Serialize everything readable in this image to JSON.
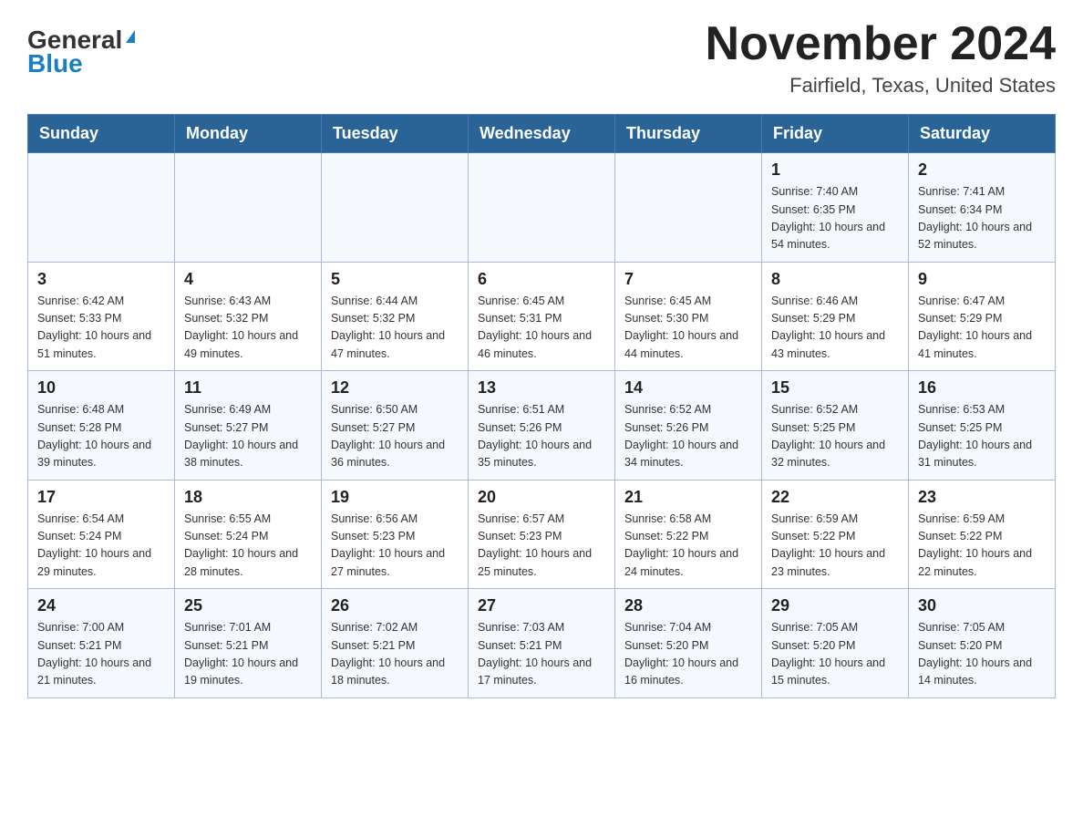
{
  "header": {
    "logo_general": "General",
    "logo_blue": "Blue",
    "title": "November 2024",
    "subtitle": "Fairfield, Texas, United States"
  },
  "calendar": {
    "days_of_week": [
      "Sunday",
      "Monday",
      "Tuesday",
      "Wednesday",
      "Thursday",
      "Friday",
      "Saturday"
    ],
    "weeks": [
      [
        {
          "day": "",
          "info": ""
        },
        {
          "day": "",
          "info": ""
        },
        {
          "day": "",
          "info": ""
        },
        {
          "day": "",
          "info": ""
        },
        {
          "day": "",
          "info": ""
        },
        {
          "day": "1",
          "info": "Sunrise: 7:40 AM\nSunset: 6:35 PM\nDaylight: 10 hours and 54 minutes."
        },
        {
          "day": "2",
          "info": "Sunrise: 7:41 AM\nSunset: 6:34 PM\nDaylight: 10 hours and 52 minutes."
        }
      ],
      [
        {
          "day": "3",
          "info": "Sunrise: 6:42 AM\nSunset: 5:33 PM\nDaylight: 10 hours and 51 minutes."
        },
        {
          "day": "4",
          "info": "Sunrise: 6:43 AM\nSunset: 5:32 PM\nDaylight: 10 hours and 49 minutes."
        },
        {
          "day": "5",
          "info": "Sunrise: 6:44 AM\nSunset: 5:32 PM\nDaylight: 10 hours and 47 minutes."
        },
        {
          "day": "6",
          "info": "Sunrise: 6:45 AM\nSunset: 5:31 PM\nDaylight: 10 hours and 46 minutes."
        },
        {
          "day": "7",
          "info": "Sunrise: 6:45 AM\nSunset: 5:30 PM\nDaylight: 10 hours and 44 minutes."
        },
        {
          "day": "8",
          "info": "Sunrise: 6:46 AM\nSunset: 5:29 PM\nDaylight: 10 hours and 43 minutes."
        },
        {
          "day": "9",
          "info": "Sunrise: 6:47 AM\nSunset: 5:29 PM\nDaylight: 10 hours and 41 minutes."
        }
      ],
      [
        {
          "day": "10",
          "info": "Sunrise: 6:48 AM\nSunset: 5:28 PM\nDaylight: 10 hours and 39 minutes."
        },
        {
          "day": "11",
          "info": "Sunrise: 6:49 AM\nSunset: 5:27 PM\nDaylight: 10 hours and 38 minutes."
        },
        {
          "day": "12",
          "info": "Sunrise: 6:50 AM\nSunset: 5:27 PM\nDaylight: 10 hours and 36 minutes."
        },
        {
          "day": "13",
          "info": "Sunrise: 6:51 AM\nSunset: 5:26 PM\nDaylight: 10 hours and 35 minutes."
        },
        {
          "day": "14",
          "info": "Sunrise: 6:52 AM\nSunset: 5:26 PM\nDaylight: 10 hours and 34 minutes."
        },
        {
          "day": "15",
          "info": "Sunrise: 6:52 AM\nSunset: 5:25 PM\nDaylight: 10 hours and 32 minutes."
        },
        {
          "day": "16",
          "info": "Sunrise: 6:53 AM\nSunset: 5:25 PM\nDaylight: 10 hours and 31 minutes."
        }
      ],
      [
        {
          "day": "17",
          "info": "Sunrise: 6:54 AM\nSunset: 5:24 PM\nDaylight: 10 hours and 29 minutes."
        },
        {
          "day": "18",
          "info": "Sunrise: 6:55 AM\nSunset: 5:24 PM\nDaylight: 10 hours and 28 minutes."
        },
        {
          "day": "19",
          "info": "Sunrise: 6:56 AM\nSunset: 5:23 PM\nDaylight: 10 hours and 27 minutes."
        },
        {
          "day": "20",
          "info": "Sunrise: 6:57 AM\nSunset: 5:23 PM\nDaylight: 10 hours and 25 minutes."
        },
        {
          "day": "21",
          "info": "Sunrise: 6:58 AM\nSunset: 5:22 PM\nDaylight: 10 hours and 24 minutes."
        },
        {
          "day": "22",
          "info": "Sunrise: 6:59 AM\nSunset: 5:22 PM\nDaylight: 10 hours and 23 minutes."
        },
        {
          "day": "23",
          "info": "Sunrise: 6:59 AM\nSunset: 5:22 PM\nDaylight: 10 hours and 22 minutes."
        }
      ],
      [
        {
          "day": "24",
          "info": "Sunrise: 7:00 AM\nSunset: 5:21 PM\nDaylight: 10 hours and 21 minutes."
        },
        {
          "day": "25",
          "info": "Sunrise: 7:01 AM\nSunset: 5:21 PM\nDaylight: 10 hours and 19 minutes."
        },
        {
          "day": "26",
          "info": "Sunrise: 7:02 AM\nSunset: 5:21 PM\nDaylight: 10 hours and 18 minutes."
        },
        {
          "day": "27",
          "info": "Sunrise: 7:03 AM\nSunset: 5:21 PM\nDaylight: 10 hours and 17 minutes."
        },
        {
          "day": "28",
          "info": "Sunrise: 7:04 AM\nSunset: 5:20 PM\nDaylight: 10 hours and 16 minutes."
        },
        {
          "day": "29",
          "info": "Sunrise: 7:05 AM\nSunset: 5:20 PM\nDaylight: 10 hours and 15 minutes."
        },
        {
          "day": "30",
          "info": "Sunrise: 7:05 AM\nSunset: 5:20 PM\nDaylight: 10 hours and 14 minutes."
        }
      ]
    ]
  }
}
